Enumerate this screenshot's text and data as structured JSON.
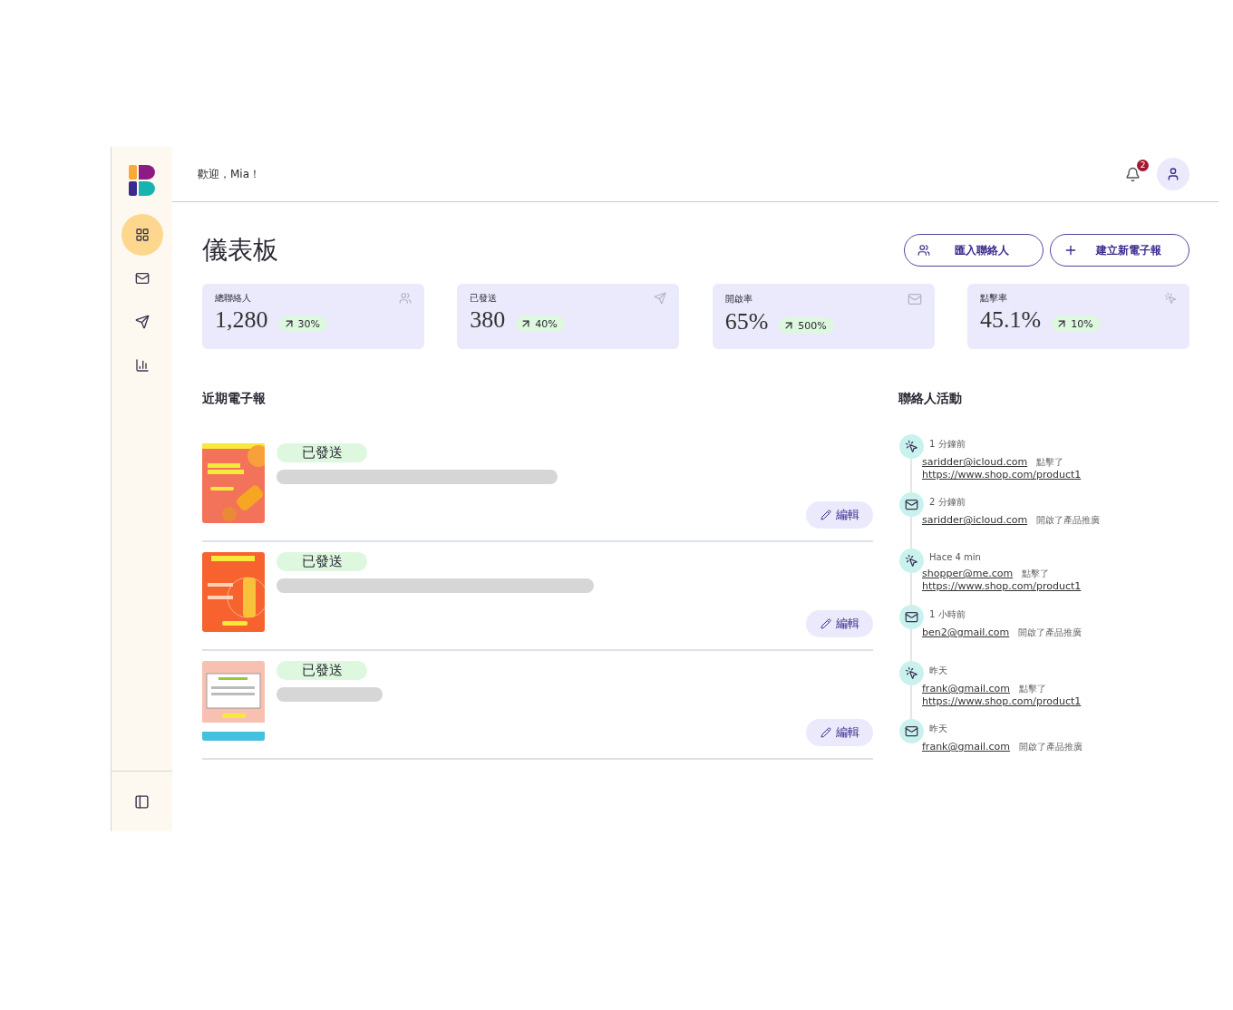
{
  "sidebar": {
    "nav": [
      {
        "kind": "dashboard",
        "selected": true
      },
      {
        "kind": "mail",
        "selected": false
      },
      {
        "kind": "send",
        "selected": false
      },
      {
        "kind": "chart",
        "selected": false
      }
    ]
  },
  "header": {
    "greeting": "歡迎，Mia！",
    "notifications": "2"
  },
  "page": {
    "title": "儀表板",
    "buttons": [
      {
        "kind": "import",
        "label": "匯入聯絡人"
      },
      {
        "kind": "create",
        "label": "建立新電子報"
      }
    ]
  },
  "stats": [
    {
      "kind": "contacts",
      "label": "總聯絡人",
      "value": "1,280",
      "change": "30%"
    },
    {
      "kind": "send",
      "label": "已發送",
      "value": "380",
      "change": "40%"
    },
    {
      "kind": "mail",
      "label": "開啟率",
      "value": "65%",
      "change": "500%"
    },
    {
      "kind": "click",
      "label": "點擊率",
      "value": "45.1%",
      "change": "10%"
    }
  ],
  "newsletters": {
    "title": "近期電子報",
    "items": [
      {
        "status": "已發送",
        "edit": "編輯"
      },
      {
        "status": "已發送",
        "edit": "編輯"
      },
      {
        "status": "已發送",
        "edit": "編輯"
      }
    ]
  },
  "activity": {
    "title": "聯絡人活動",
    "items": [
      {
        "kind": "click",
        "time": "1 分鐘前",
        "email": "saridder@icloud.com",
        "action": "點擊了",
        "url": "https://www.shop.com/product1"
      },
      {
        "kind": "open",
        "time": "2 分鐘前",
        "email": "saridder@icloud.com",
        "action": "開啟了產品推廣"
      },
      {
        "kind": "click",
        "time": "Hace 4 min",
        "email": "shopper@me.com",
        "action": "點擊了",
        "url": "https://www.shop.com/product1"
      },
      {
        "kind": "open",
        "time": "1 小時前",
        "email": "ben2@gmail.com",
        "action": "開啟了產品推廣"
      },
      {
        "kind": "click",
        "time": "昨天",
        "email": "frank@gmail.com",
        "action": "點擊了",
        "url": "https://www.shop.com/product1"
      },
      {
        "kind": "open",
        "time": "昨天",
        "email": "frank@gmail.com",
        "action": "開啟了產品推廣"
      }
    ]
  }
}
